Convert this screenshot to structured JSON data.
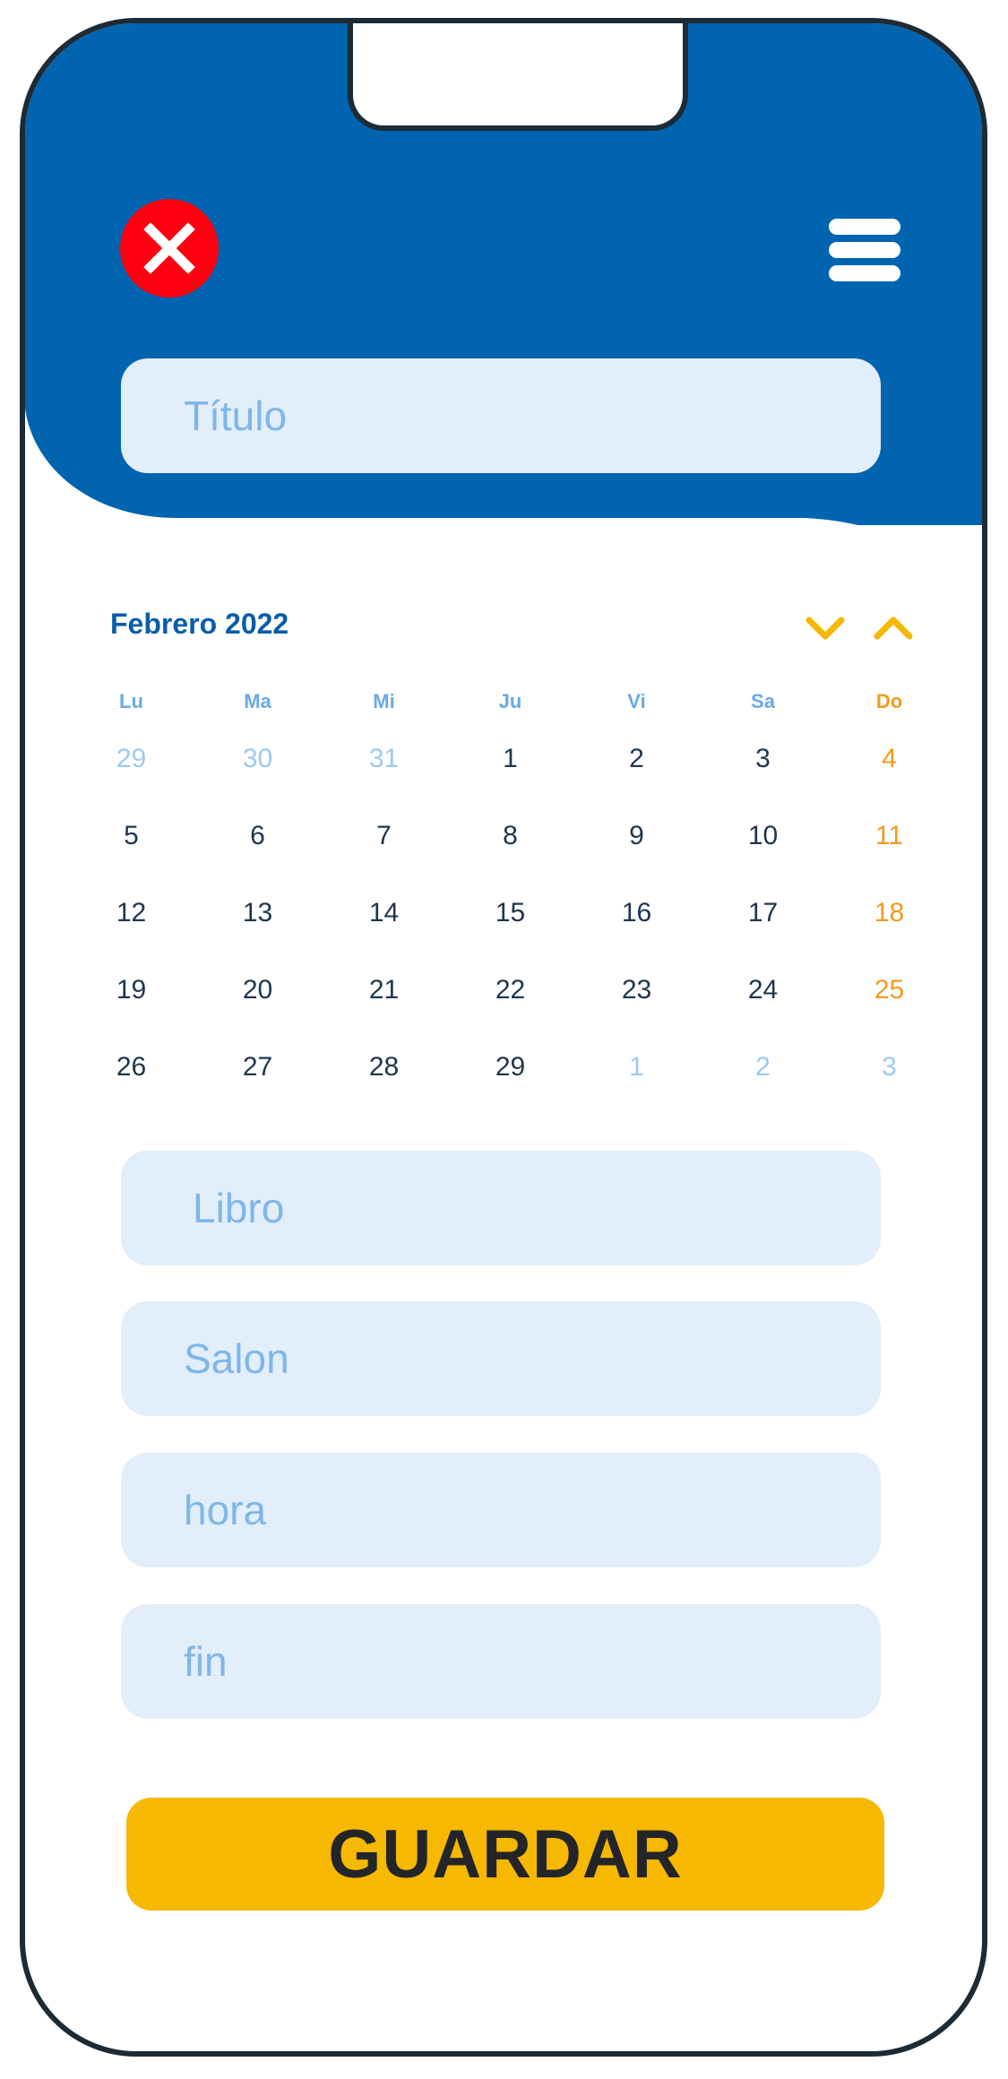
{
  "colors": {
    "header_blue": "#0064b0",
    "close_red": "#ff0010",
    "accent_yellow": "#f6b800",
    "sunday_orange": "#f39a1f"
  },
  "header": {
    "close_icon": "close-icon",
    "menu_icon": "hamburger-menu-icon"
  },
  "form": {
    "title_placeholder": "Título",
    "libro_placeholder": "Libro",
    "salon_placeholder": "Salon",
    "hora_placeholder": "hora",
    "fin_placeholder": "fin",
    "save_label": "GUARDAR"
  },
  "calendar": {
    "month_label": "Febrero 2022",
    "prev_icon": "chevron-down-icon",
    "next_icon": "chevron-up-icon",
    "weekdays": [
      "Lu",
      "Ma",
      "Mi",
      "Ju",
      "Vi",
      "Sa",
      "Do"
    ],
    "weeks": [
      [
        "29",
        "30",
        "31",
        "1",
        "2",
        "3",
        "4"
      ],
      [
        "5",
        "6",
        "7",
        "8",
        "9",
        "10",
        "11"
      ],
      [
        "12",
        "13",
        "14",
        "15",
        "16",
        "17",
        "18"
      ],
      [
        "19",
        "20",
        "21",
        "22",
        "23",
        "24",
        "25"
      ],
      [
        "26",
        "27",
        "28",
        "29",
        "1",
        "2",
        "3"
      ]
    ]
  }
}
